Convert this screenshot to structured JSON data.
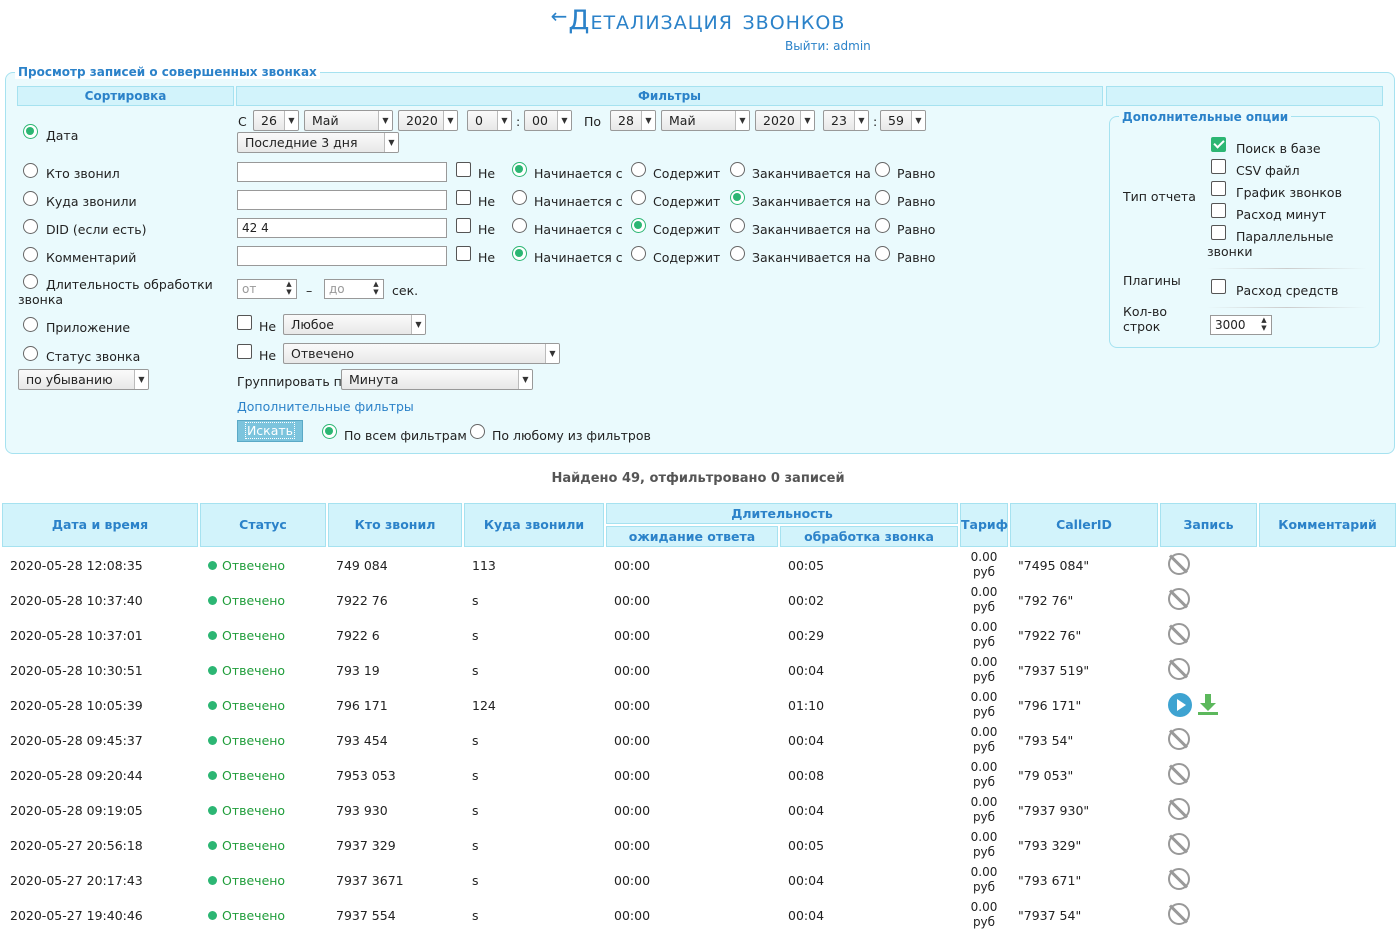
{
  "header": {
    "title": "Детализация звонков",
    "logout": "Выйти: admin"
  },
  "panel": {
    "legend": "Просмотр записей о совершенных звонках",
    "col_sort": "Сортировка",
    "col_filters": "Фильтры",
    "date": {
      "from_label": "С",
      "from_day": "26",
      "from_month": "Май",
      "from_year": "2020",
      "from_hour": "0",
      "from_min": "00",
      "colon": ":",
      "to_label": "По",
      "to_day": "28",
      "to_month": "Май",
      "to_year": "2020",
      "to_hour": "23",
      "to_min": "59",
      "preset": "Последние 3 дня"
    },
    "sort_options": [
      "Дата",
      "Кто звонил",
      "Куда звонили",
      "DID (если есть)",
      "Комментарий",
      "Длительность обработки",
      "звонка",
      "Приложение",
      "Статус звонка"
    ],
    "sort_order": "по убыванию",
    "filter_fields": [
      {
        "value": "",
        "not": "Не",
        "a": "Начинается с",
        "b": "Содержит",
        "c": "Заканчивается на",
        "d": "Равно"
      },
      {
        "value": "",
        "not": "Не",
        "a": "Начинается с",
        "b": "Содержит",
        "c": "Заканчивается на",
        "d": "Равно"
      },
      {
        "value": "42   4",
        "not": "Не",
        "a": "Начинается с",
        "b": "Содержит",
        "c": "Заканчивается на",
        "d": "Равно"
      },
      {
        "value": "",
        "not": "Не",
        "a": "Начинается с",
        "b": "Содержит",
        "c": "Заканчивается на",
        "d": "Равно"
      }
    ],
    "duration": {
      "from_ph": "от",
      "dash": "–",
      "to_ph": "до",
      "unit": "сек."
    },
    "app": {
      "not": "Не",
      "value": "Любое"
    },
    "status": {
      "not": "Не",
      "value": "Отвечено"
    },
    "group": {
      "label": "Группировать по",
      "value": "Минута"
    },
    "extra_filters": "Дополнительные фильтры",
    "search_btn": "Искать",
    "match_all": "По всем фильтрам",
    "match_any": "По любому из фильтров",
    "options": {
      "legend": "Дополнительные опции",
      "report_type": "Тип отчета",
      "report_items": [
        "Поиск в базе",
        "CSV файл",
        "График звонков",
        "Расход минут",
        "Параллельные",
        "звонки"
      ],
      "plugins": "Плагины",
      "plugin_item": "Расход средств",
      "rows_label": "Кол-во",
      "rows_label2": "строк",
      "rows_value": "3000"
    }
  },
  "found": "Найдено 49, отфильтровано 0 записей",
  "table": {
    "headers": {
      "datetime": "Дата и время",
      "status": "Статус",
      "caller": "Кто звонил",
      "callee": "Куда звонили",
      "duration": "Длительность",
      "wait": "ожидание ответа",
      "handle": "обработка звонка",
      "tariff": "Тариф",
      "callerid": "CallerID",
      "record": "Запись",
      "comment": "Комментарий"
    },
    "rows": [
      {
        "dt": "2020-05-28 12:08:35",
        "status": "Отвечено",
        "caller": "749   084",
        "callee": "113",
        "wait": "00:00",
        "handle": "00:05",
        "tariff": "0.00",
        "cur": "руб",
        "cid": "\"7495       084\"",
        "rec": false
      },
      {
        "dt": "2020-05-28 10:37:40",
        "status": "Отвечено",
        "caller": "7922   76",
        "callee": "s",
        "wait": "00:00",
        "handle": "00:02",
        "tariff": "0.00",
        "cur": "руб",
        "cid": "\"792       76\"",
        "rec": false
      },
      {
        "dt": "2020-05-28 10:37:01",
        "status": "Отвечено",
        "caller": "7922   6",
        "callee": "s",
        "wait": "00:00",
        "handle": "00:29",
        "tariff": "0.00",
        "cur": "руб",
        "cid": "\"7922      76\"",
        "rec": false
      },
      {
        "dt": "2020-05-28 10:30:51",
        "status": "Отвечено",
        "caller": "793   19",
        "callee": "s",
        "wait": "00:00",
        "handle": "00:04",
        "tariff": "0.00",
        "cur": "руб",
        "cid": "\"7937       519\"",
        "rec": false
      },
      {
        "dt": "2020-05-28 10:05:39",
        "status": "Отвечено",
        "caller": "796   171",
        "callee": "124",
        "wait": "00:00",
        "handle": "01:10",
        "tariff": "0.00",
        "cur": "руб",
        "cid": "\"796        171\"",
        "rec": true
      },
      {
        "dt": "2020-05-28 09:45:37",
        "status": "Отвечено",
        "caller": "793   454",
        "callee": "s",
        "wait": "00:00",
        "handle": "00:04",
        "tariff": "0.00",
        "cur": "руб",
        "cid": "\"793        54\"",
        "rec": false
      },
      {
        "dt": "2020-05-28 09:20:44",
        "status": "Отвечено",
        "caller": "7953   053",
        "callee": "s",
        "wait": "00:00",
        "handle": "00:08",
        "tariff": "0.00",
        "cur": "руб",
        "cid": "\"79        053\"",
        "rec": false
      },
      {
        "dt": "2020-05-28 09:19:05",
        "status": "Отвечено",
        "caller": "793   930",
        "callee": "s",
        "wait": "00:00",
        "handle": "00:04",
        "tariff": "0.00",
        "cur": "руб",
        "cid": "\"7937       930\"",
        "rec": false
      },
      {
        "dt": "2020-05-27 20:56:18",
        "status": "Отвечено",
        "caller": "7937   329",
        "callee": "s",
        "wait": "00:00",
        "handle": "00:05",
        "tariff": "0.00",
        "cur": "руб",
        "cid": "\"793        329\"",
        "rec": false
      },
      {
        "dt": "2020-05-27 20:17:43",
        "status": "Отвечено",
        "caller": "7937   3671",
        "callee": "s",
        "wait": "00:00",
        "handle": "00:04",
        "tariff": "0.00",
        "cur": "руб",
        "cid": "\"793        671\"",
        "rec": false
      },
      {
        "dt": "2020-05-27 19:40:46",
        "status": "Отвечено",
        "caller": "7937   554",
        "callee": "s",
        "wait": "00:00",
        "handle": "00:04",
        "tariff": "0.00",
        "cur": "руб",
        "cid": "\"7937       54\"",
        "rec": false
      }
    ]
  },
  "colors": {
    "accent": "#2b82c9",
    "header_bg": "#d2f3fb",
    "border": "#a6e2f0",
    "ok": "#2cb673"
  }
}
